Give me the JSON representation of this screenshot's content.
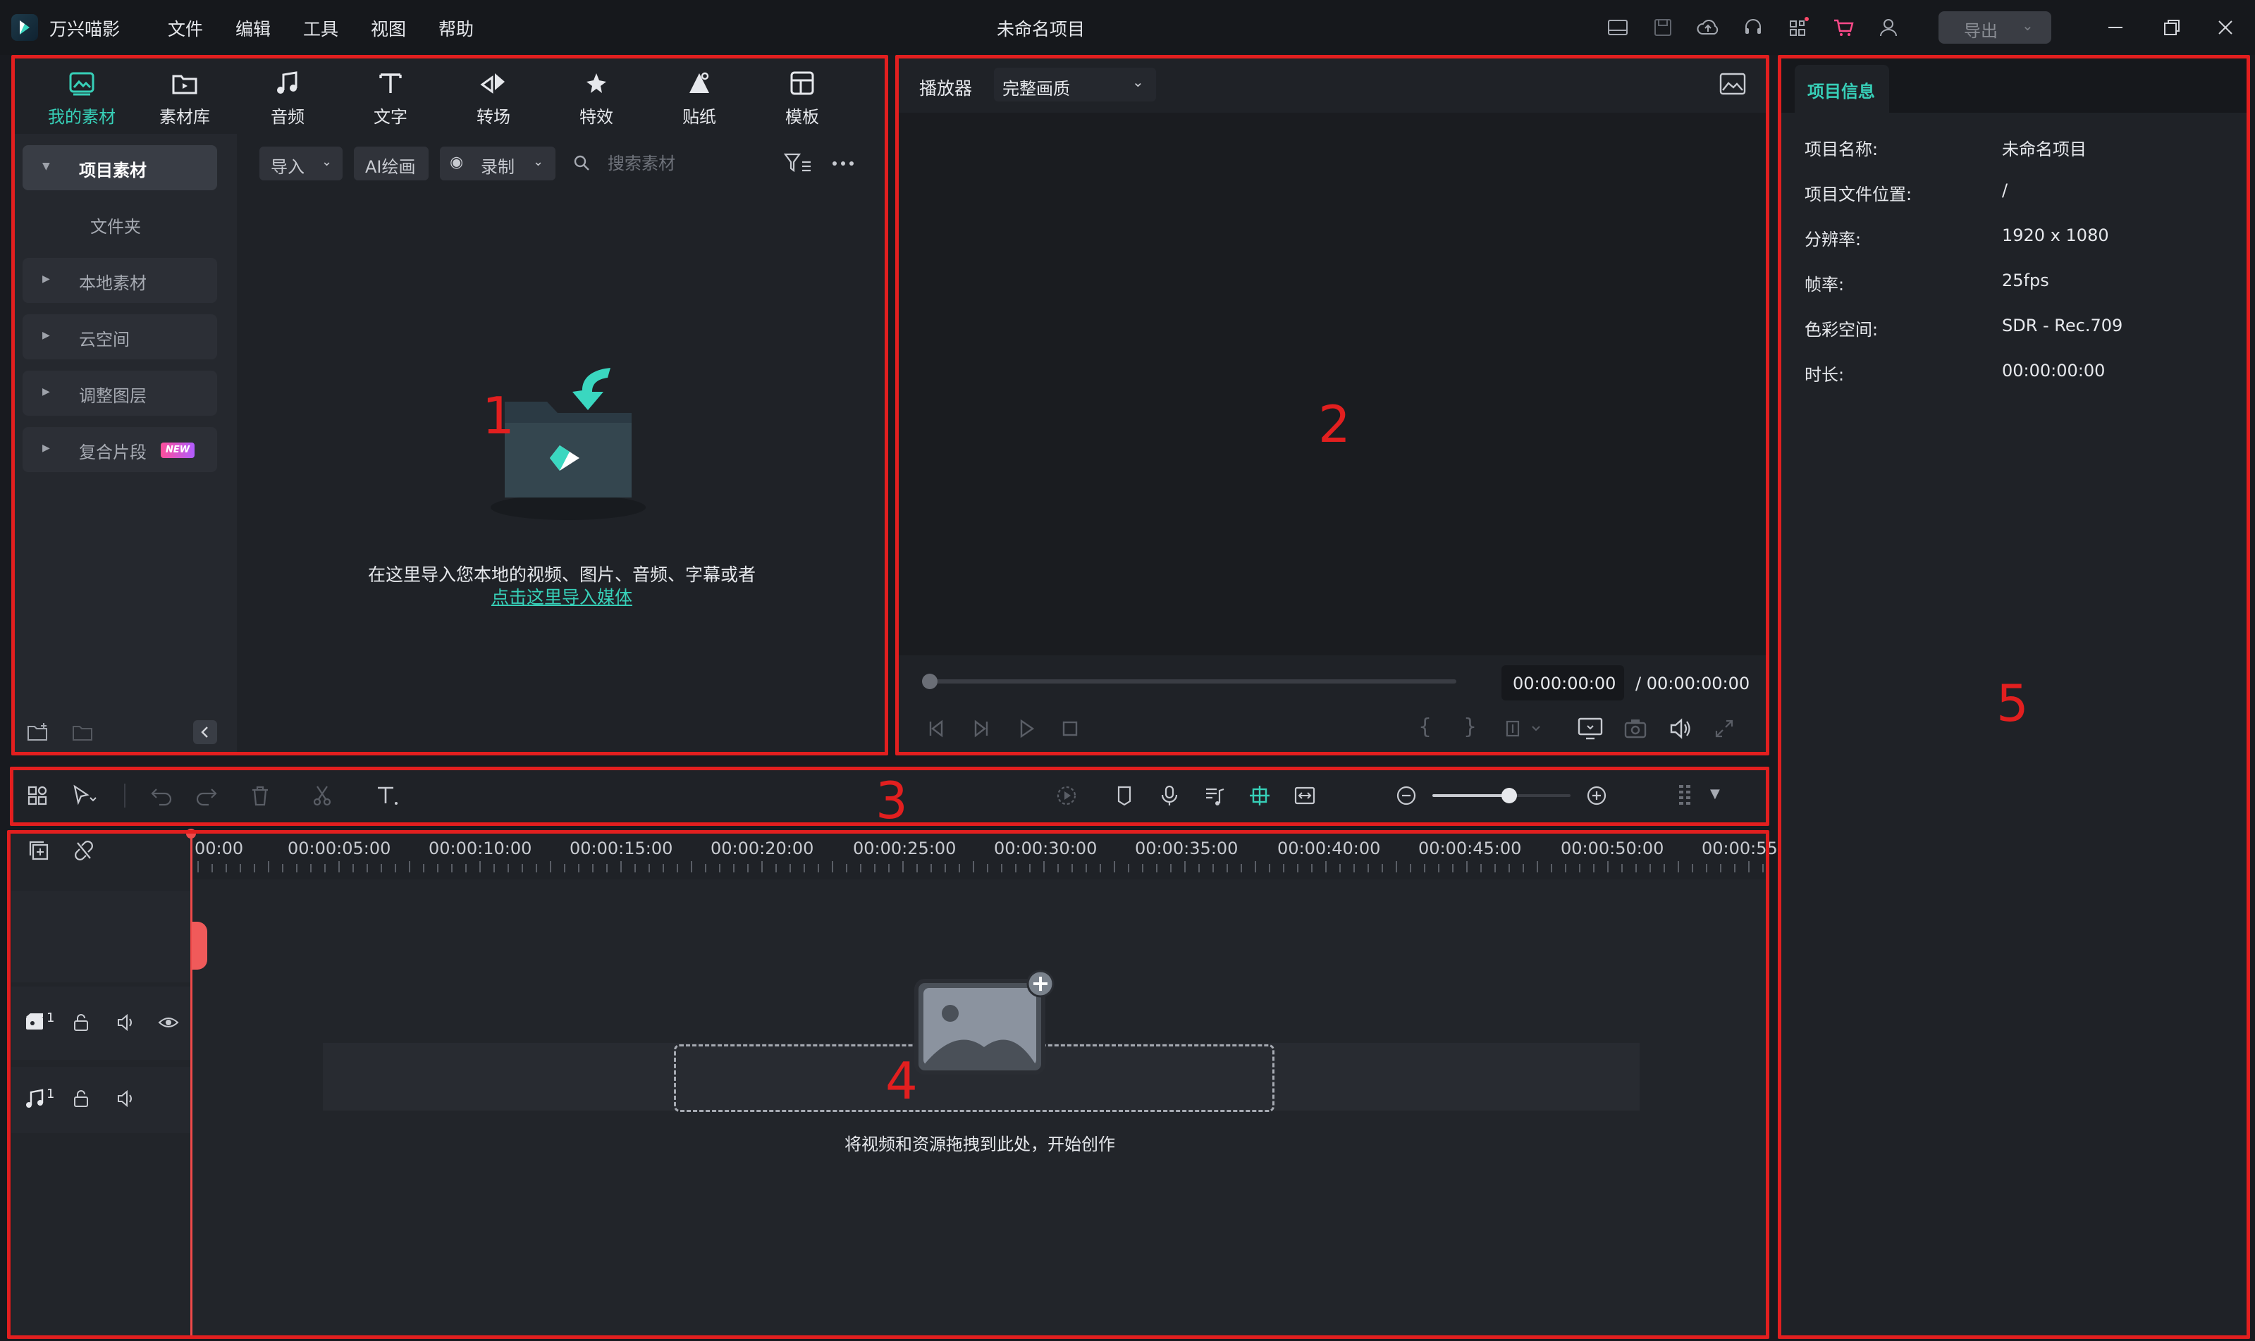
{
  "app": {
    "name": "万兴喵影",
    "window_title": "未命名项目",
    "export_label": "导出"
  },
  "menu": [
    "文件",
    "编辑",
    "工具",
    "视图",
    "帮助"
  ],
  "media": {
    "tabs": [
      {
        "label": "我的素材",
        "icon": "my-media-icon",
        "active": true
      },
      {
        "label": "素材库",
        "icon": "stock-library-icon"
      },
      {
        "label": "音频",
        "icon": "music-note-icon"
      },
      {
        "label": "文字",
        "icon": "text-icon"
      },
      {
        "label": "转场",
        "icon": "transition-icon"
      },
      {
        "label": "特效",
        "icon": "effects-icon"
      },
      {
        "label": "贴纸",
        "icon": "sticker-icon"
      },
      {
        "label": "模板",
        "icon": "template-icon"
      }
    ],
    "sidebar": {
      "project_media": "项目素材",
      "folder": "文件夹",
      "local_media": "本地素材",
      "cloud_space": "云空间",
      "adjustment_layer": "调整图层",
      "compound_clip": "复合片段",
      "new_badge": "NEW"
    },
    "toolbar": {
      "import": "导入",
      "ai_paint": "AI绘画",
      "record": "录制",
      "search_placeholder": "搜索素材"
    },
    "empty_text": "在这里导入您本地的视频、图片、音频、字幕或者",
    "empty_link": "点击这里导入媒体"
  },
  "player": {
    "label": "播放器",
    "quality": "完整画质",
    "current_time": "00:00:00:00",
    "total_time": "/ 00:00:00:00"
  },
  "timeline": {
    "ruler": [
      "00:00",
      "00:00:05:00",
      "00:00:10:00",
      "00:00:15:00",
      "00:00:20:00",
      "00:00:25:00",
      "00:00:30:00",
      "00:00:35:00",
      "00:00:40:00",
      "00:00:45:00",
      "00:00:50:00",
      "00:00:55"
    ],
    "video_track_number": "1",
    "audio_track_number": "1",
    "drop_hint": "将视频和资源拖拽到此处，开始创作"
  },
  "info": {
    "tab": "项目信息",
    "rows": [
      {
        "label": "项目名称:",
        "value": "未命名项目"
      },
      {
        "label": "项目文件位置:",
        "value": "/"
      },
      {
        "label": "分辨率:",
        "value": "1920 x 1080"
      },
      {
        "label": "帧率:",
        "value": "25fps"
      },
      {
        "label": "色彩空间:",
        "value": "SDR - Rec.709"
      },
      {
        "label": "时长:",
        "value": "00:00:00:00"
      }
    ]
  },
  "annotations": [
    "1",
    "2",
    "3",
    "4",
    "5"
  ],
  "colors": {
    "accent": "#37d0b8",
    "annotation": "#e21f1f",
    "playhead": "#f04a4a"
  }
}
